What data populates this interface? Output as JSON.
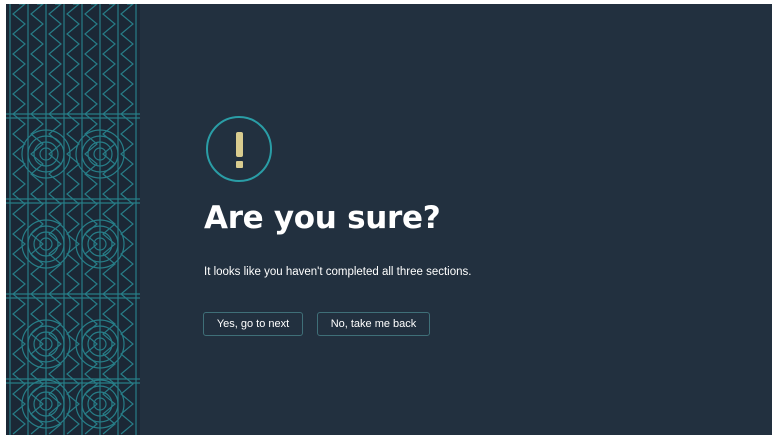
{
  "dialog": {
    "icon": "exclamation-icon",
    "title": "Are you sure?",
    "message": "It looks like you haven't completed all three sections.",
    "confirm_label": "Yes, go to next",
    "cancel_label": "No, take me back"
  },
  "colors": {
    "background": "#22303f",
    "pattern_background": "#1b2836",
    "pattern_line": "#2a8c96",
    "icon_ring": "#2a9da6",
    "icon_mark": "#d9cc8f",
    "button_border": "#3f6f78",
    "text": "#ffffff"
  }
}
